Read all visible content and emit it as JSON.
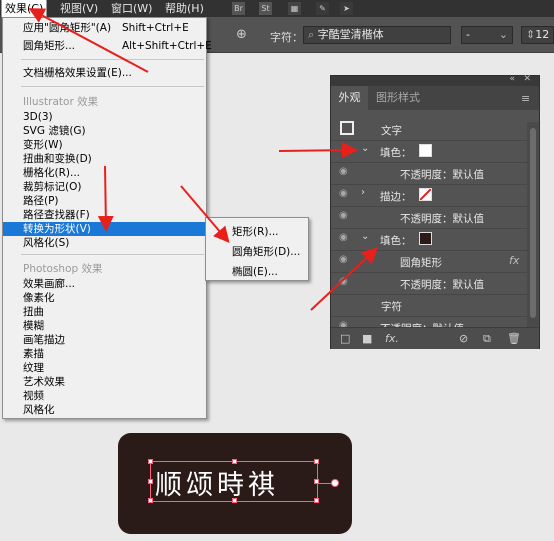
{
  "menubar": {
    "items": [
      "效果(C)",
      "视图(V)",
      "窗口(W)",
      "帮助(H)"
    ],
    "active_index": 0,
    "right_icons": [
      "Br",
      "St"
    ]
  },
  "controlbar": {
    "font_label": "字符：",
    "font_name": "字酷堂清楷体",
    "font_style": "-",
    "font_size": "12"
  },
  "effect_menu": {
    "top_items": [
      {
        "label": "应用\"圆角矩形\"(A)",
        "shortcut": "Shift+Ctrl+E"
      },
      {
        "label": "圆角矩形...",
        "shortcut": "Alt+Shift+Ctrl+E"
      }
    ],
    "raster_settings": "文档栅格效果设置(E)...",
    "illustrator_header": "Illustrator 效果",
    "illustrator_items": [
      "3D(3)",
      "SVG 滤镜(G)",
      "变形(W)",
      "扭曲和变换(D)",
      "栅格化(R)...",
      "裁剪标记(O)",
      "路径(P)",
      "路径查找器(F)",
      "转换为形状(V)",
      "风格化(S)"
    ],
    "highlighted_item": "转换为形状(V)",
    "photoshop_header": "Photoshop 效果",
    "photoshop_items": [
      "效果画廊...",
      "像素化",
      "扭曲",
      "模糊",
      "画笔描边",
      "素描",
      "纹理",
      "艺术效果",
      "视频",
      "风格化"
    ]
  },
  "submenu": {
    "items": [
      "矩形(R)...",
      "圆角矩形(D)...",
      "椭圆(E)..."
    ]
  },
  "appearance_panel": {
    "tabs": [
      "外观",
      "图形样式"
    ],
    "object_label": "文字",
    "fill1_label": "填色：",
    "opacity_label": "不透明度：默认值",
    "stroke_label": "描边：",
    "fill2_label": "填色：",
    "effect_label": "圆角矩形",
    "char_label": "字符",
    "fx_symbol": "fx"
  },
  "artwork": {
    "text": "顺颂時祺"
  },
  "colors": {
    "highlight": "#1a78d7",
    "annotation_red": "#e8201c",
    "artwork_bg": "#2a1b18"
  }
}
